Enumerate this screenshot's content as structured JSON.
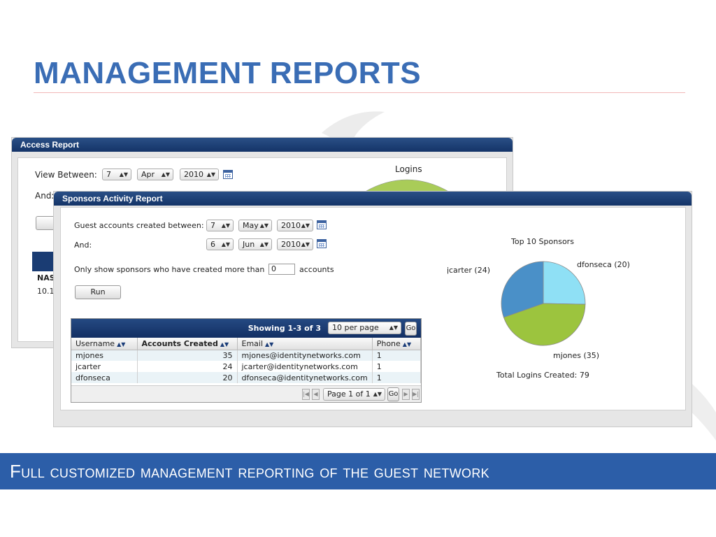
{
  "slide": {
    "title": "MANAGEMENT REPORTS",
    "footer": "Full customized management reporting of the guest network"
  },
  "access_report": {
    "title": "Access Report",
    "view_between_label": "View Between:",
    "and_label": "And:",
    "from": {
      "day": "7",
      "month": "Apr",
      "year": "2010"
    },
    "chart_title": "Logins",
    "table_header_partial": "NAS",
    "table_cell_partial": "10.1"
  },
  "sponsors_report": {
    "title": "Sponsors Activity Report",
    "created_between_label": "Guest accounts created between:",
    "and_label": "And:",
    "from": {
      "day": "7",
      "month": "May",
      "year": "2010"
    },
    "to": {
      "day": "6",
      "month": "Jun",
      "year": "2010"
    },
    "only_show_label": "Only show sponsors who have created more than",
    "min_accounts_value": "0",
    "accounts_label": "accounts",
    "run_button": "Run",
    "grid": {
      "showing": "Showing 1-3 of 3",
      "per_page": "10 per page",
      "go": "Go",
      "columns": [
        "Username",
        "Accounts Created",
        "Email",
        "Phone"
      ],
      "rows": [
        {
          "username": "mjones",
          "accounts": "35",
          "email": "mjones@identitynetworks.com",
          "phone": "1"
        },
        {
          "username": "jcarter",
          "accounts": "24",
          "email": "jcarter@identitynetworks.com",
          "phone": "1"
        },
        {
          "username": "dfonseca",
          "accounts": "20",
          "email": "dfonseca@identitynetworks.com",
          "phone": "1"
        }
      ],
      "page_label": "Page 1 of 1",
      "page_go": "Go"
    },
    "chart": {
      "title": "Top 10 Sponsors",
      "total": "Total Logins Created: 79"
    }
  },
  "chart_data": {
    "type": "pie",
    "title": "Top 10 Sponsors",
    "labels": [
      "dfonseca (20)",
      "jcarter (24)",
      "mjones (35)"
    ],
    "values": [
      20,
      24,
      35
    ],
    "colors": [
      "#8fe0f5",
      "#4a90c8",
      "#9cc43e"
    ]
  },
  "colors": {
    "title": "#3a6db5",
    "header_bar": "#1a3c73",
    "footer_band": "#2c5ea8"
  }
}
